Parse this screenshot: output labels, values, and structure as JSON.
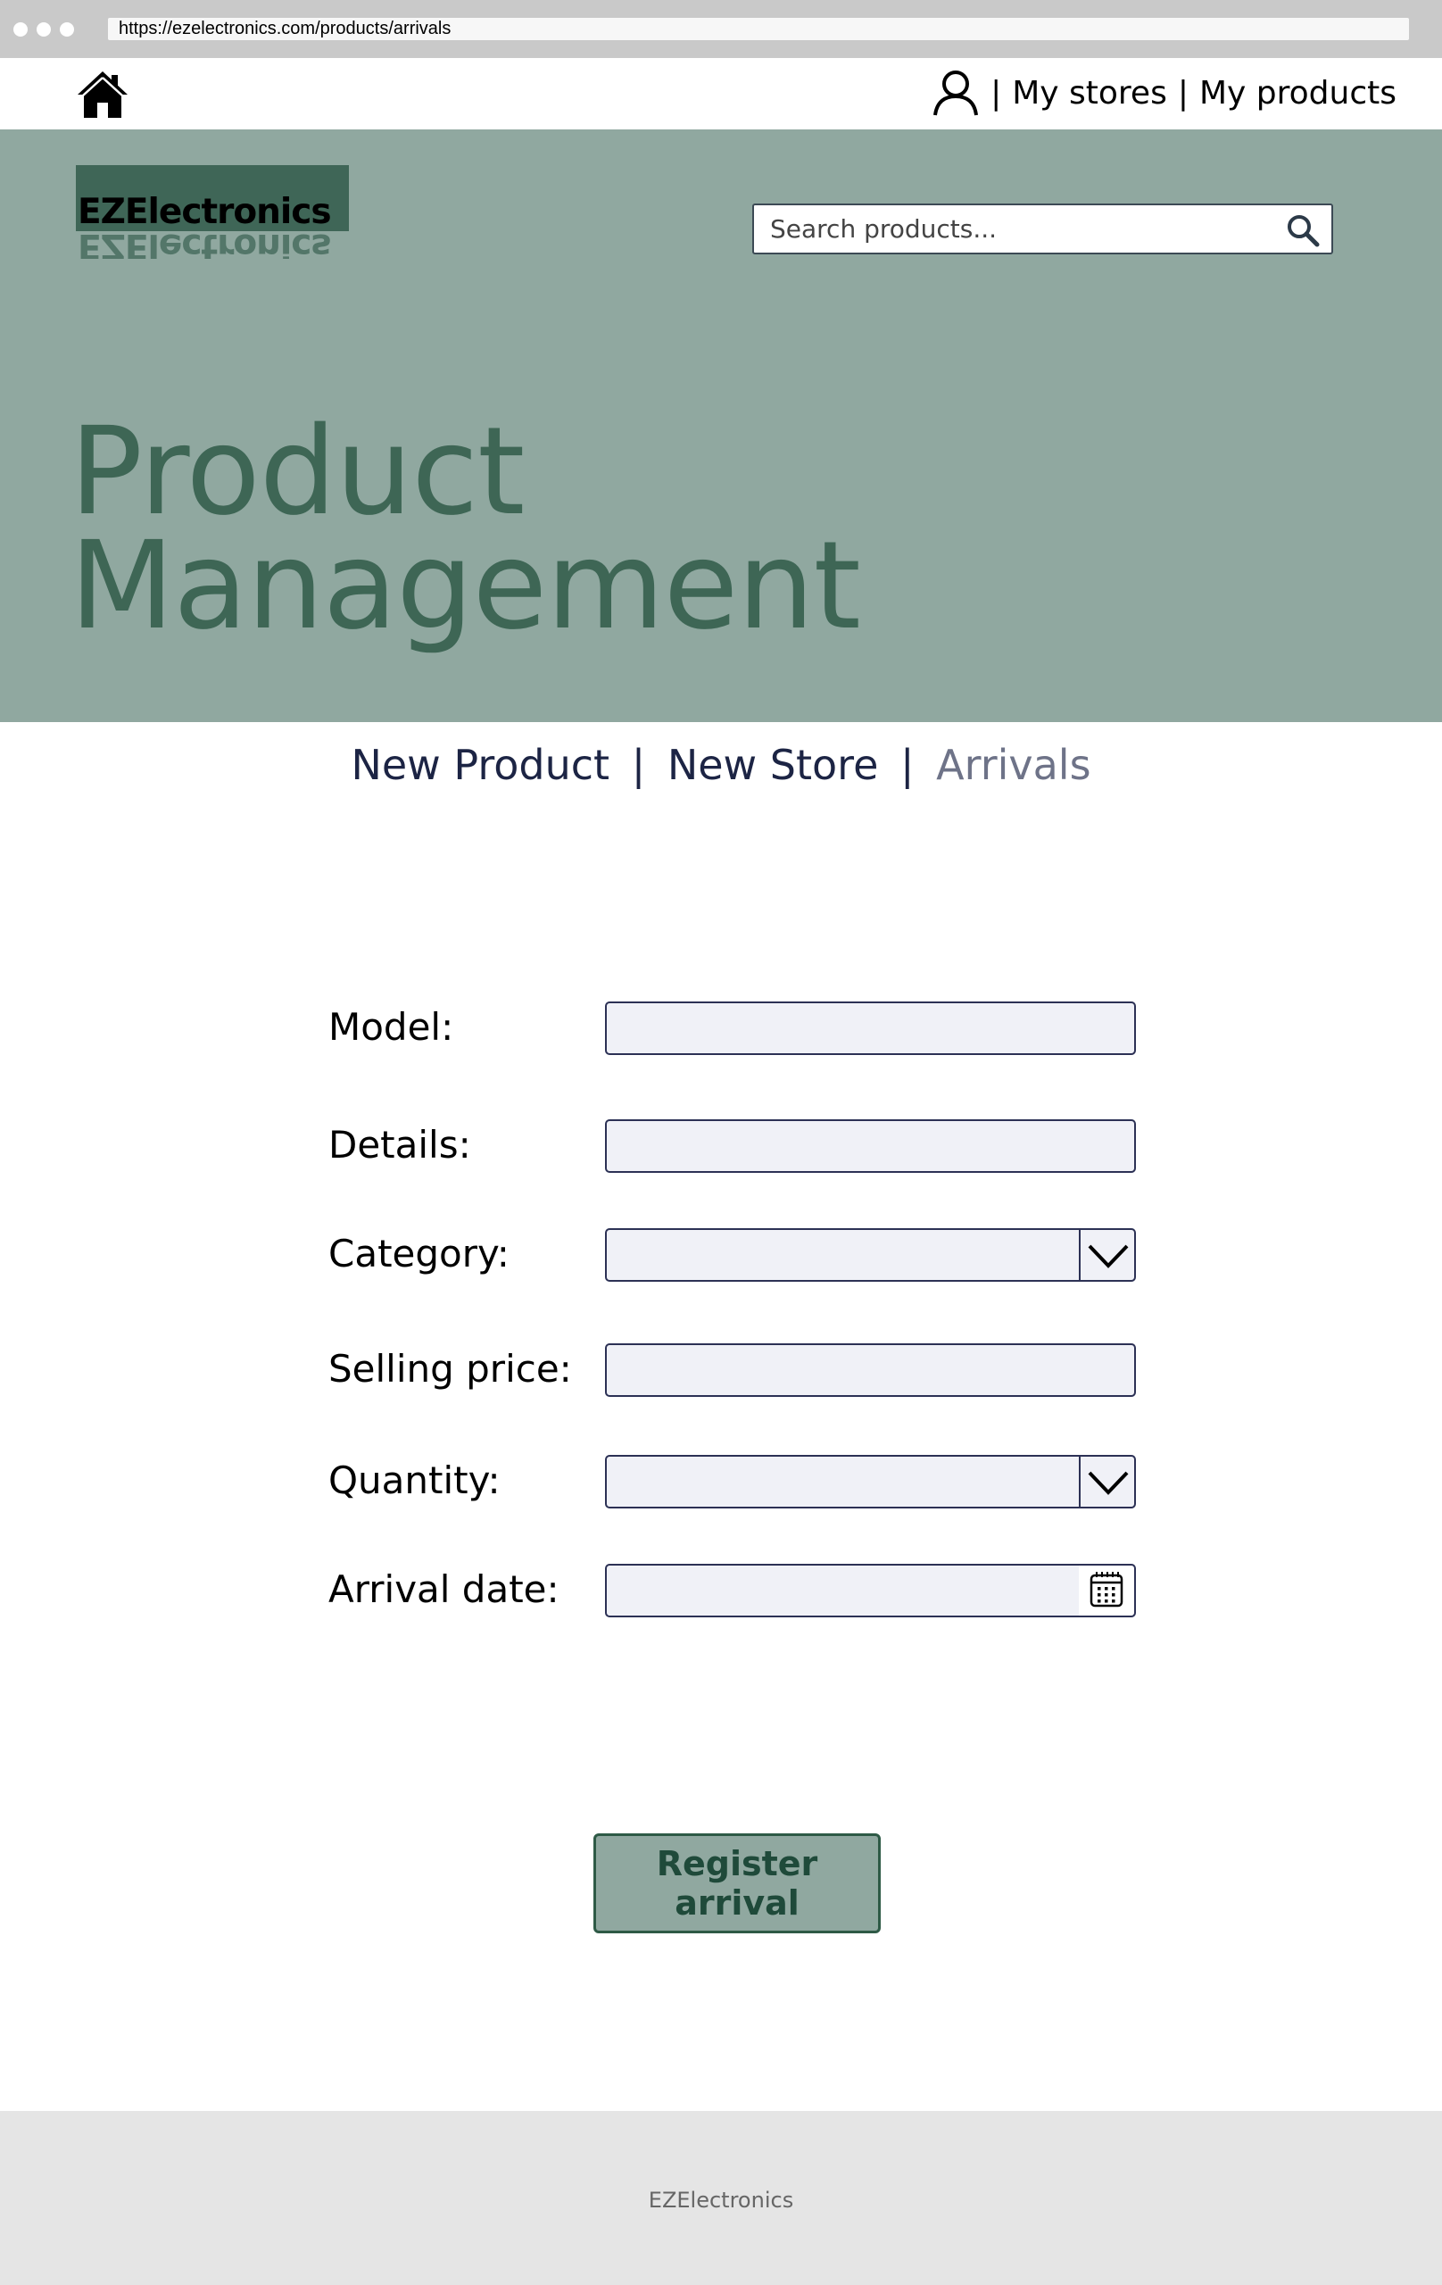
{
  "browser": {
    "url": "https://ezelectronics.com/products/arrivals"
  },
  "topnav": {
    "home_icon": "home-icon",
    "user_icon": "user-icon",
    "separator": "|",
    "my_stores": "My stores",
    "my_products": "My products"
  },
  "header": {
    "logo": "EZElectronics",
    "search_placeholder": "Search products...",
    "search_icon": "search-icon",
    "title_line1": "Product",
    "title_line2": "Management"
  },
  "subnav": {
    "items": [
      {
        "label": "New Product",
        "active": false
      },
      {
        "label": "New Store",
        "active": false
      },
      {
        "label": "Arrivals",
        "active": true
      }
    ],
    "separator": "|"
  },
  "form": {
    "model_label": "Model:",
    "model_value": "",
    "details_label": "Details:",
    "details_value": "",
    "category_label": "Category:",
    "category_value": "",
    "price_label": "Selling price:",
    "price_value": "",
    "quantity_label": "Quantity:",
    "quantity_value": "",
    "date_label": "Arrival date:",
    "date_value": "",
    "submit_label": "Register arrival"
  },
  "footer": {
    "text": "EZElectronics"
  },
  "colors": {
    "header_bg": "#90a8a0",
    "title_text": "#3e6655",
    "logo_bg": "#3f6657",
    "field_bg": "#f0f1f7",
    "field_border": "#2c3155",
    "footer_bg": "#e5e5e5"
  }
}
